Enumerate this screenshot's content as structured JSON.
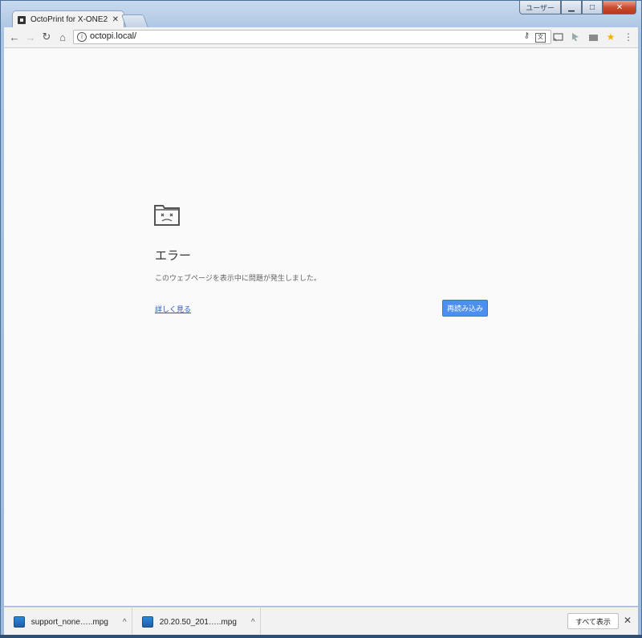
{
  "window": {
    "caption_user": "ユーザー",
    "min": "▁",
    "max": "□",
    "close": "✕"
  },
  "tabs": [
    {
      "title": "OctoPrint for X-ONE2",
      "close": "✕"
    }
  ],
  "toolbar": {
    "back": "←",
    "forward": "→",
    "reload": "↻",
    "home": "⌂",
    "info_icon": "i",
    "url": "octopi.local/",
    "key_icon": "⚷",
    "translate_icon": "文",
    "menu": "⋮",
    "star": "★"
  },
  "error_page": {
    "title": "エラー",
    "description": "このウェブページを表示中に問題が発生しました。",
    "details_link": "詳しく見る",
    "reload_button": "再読み込み"
  },
  "downloads": {
    "items": [
      {
        "name": "support_none…..mpg",
        "caret": "^"
      },
      {
        "name": "20.20.50_201…..mpg",
        "caret": "^"
      }
    ],
    "show_all": "すべて表示",
    "close": "✕"
  },
  "colors": {
    "accent": "#4d8ff1",
    "link": "#2b59bc",
    "content_bg": "#fafafa"
  }
}
